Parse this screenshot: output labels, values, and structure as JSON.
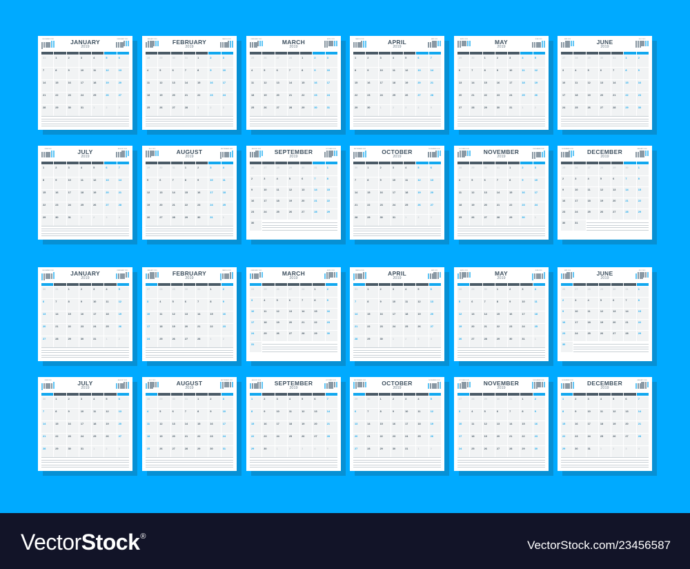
{
  "year": "2019",
  "colors": {
    "background": "#00aaff",
    "shadow": "#0790d4",
    "page": "#ffffff",
    "header_dark": "#4a5a66",
    "accent": "#11a7ee",
    "text": "#3d4f5e",
    "footer": "#121428"
  },
  "months": [
    "JANUARY",
    "FEBRUARY",
    "MARCH",
    "APRIL",
    "MAY",
    "JUNE",
    "JULY",
    "AUGUST",
    "SEPTEMBER",
    "OCTOBER",
    "NOVEMBER",
    "DECEMBER"
  ],
  "weekday_labels_monday": [
    "Monday",
    "Tuesday",
    "Wednesday",
    "Thursday",
    "Friday",
    "Saturday",
    "Sunday"
  ],
  "weekday_labels_sunday": [
    "Sunday",
    "Monday",
    "Tuesday",
    "Wednesday",
    "Thursday",
    "Friday",
    "Saturday"
  ],
  "sets": [
    {
      "name": "monday-start",
      "week_start": "monday",
      "weekend_columns": [
        "Saturday",
        "Sunday"
      ]
    },
    {
      "name": "sunday-start",
      "week_start": "sunday",
      "weekend_columns": [
        "Sunday",
        "Saturday"
      ]
    }
  ],
  "footer": {
    "brand_thin": "Vector",
    "brand_bold": "Stock",
    "registered": "®",
    "url": "VectorStock.com/23456587"
  }
}
